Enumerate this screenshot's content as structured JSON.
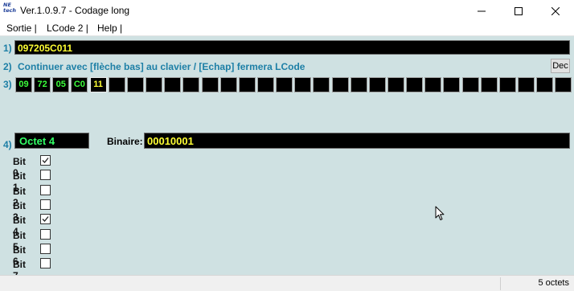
{
  "window": {
    "logo_text": "NEtech",
    "title": "Ver.1.0.9.7 - Codage long",
    "controls": [
      "minimize",
      "maximize",
      "close"
    ]
  },
  "menu": {
    "items": [
      "Sortie |",
      "LCode 2 |",
      "Help |"
    ]
  },
  "rows": {
    "r1": "1)",
    "r2": "2)",
    "r3": "3)",
    "r4": "4)"
  },
  "code_value": "097205C011",
  "hint_text": "Continuer avec [flèche bas] au clavier / [Echap] fermera LCode",
  "dec_label": "Dec",
  "bytes": {
    "values": [
      "09",
      "72",
      "05",
      "C0",
      "11"
    ],
    "empty_cells": 25
  },
  "octet_label": "Octet 4",
  "binary": {
    "label": "Binaire:",
    "value": "00010001"
  },
  "bits": [
    {
      "label": "Bit 0",
      "checked": true
    },
    {
      "label": "Bit 1",
      "checked": false
    },
    {
      "label": "Bit 2",
      "checked": false
    },
    {
      "label": "Bit 3",
      "checked": false
    },
    {
      "label": "Bit 4",
      "checked": true
    },
    {
      "label": "Bit 5",
      "checked": false
    },
    {
      "label": "Bit 6",
      "checked": false
    },
    {
      "label": "Bit 7",
      "checked": false
    }
  ],
  "status": {
    "text": "5 octets"
  },
  "colors": {
    "background": "#cfe1e2",
    "label_blue": "#1d7fa6",
    "value_yellow": "#ffff33",
    "value_green": "#3cff3c"
  },
  "icons": {
    "minimize": "minimize-icon",
    "maximize": "maximize-icon",
    "close": "close-icon",
    "check": "checkmark-icon",
    "cursor": "mouse-pointer-icon"
  }
}
